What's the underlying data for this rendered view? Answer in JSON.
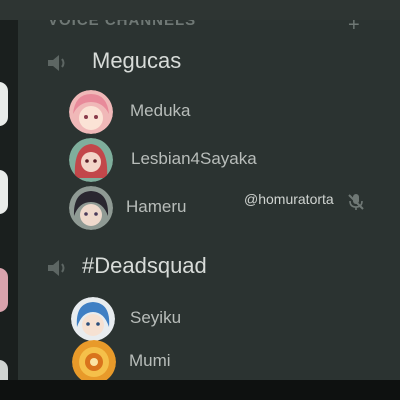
{
  "section_header": {
    "title": "VOICE CHANNELS",
    "add_icon": "plus-icon"
  },
  "channels": [
    {
      "name": "Megucas",
      "icon": "speaker-icon",
      "members": [
        {
          "name": "Meduka",
          "avatar": "pink-haired-anime-avatar"
        },
        {
          "name": "Lesbian4Sayaka",
          "avatar": "red-haired-anime-avatar"
        },
        {
          "name": "Hameru",
          "avatar": "dark-haired-anime-avatar"
        }
      ]
    },
    {
      "name": "#Deadsquad",
      "icon": "speaker-icon",
      "members": [
        {
          "name": "Seyiku",
          "avatar": "blue-haired-anime-avatar"
        },
        {
          "name": "Mumi",
          "avatar": "orange-cartoon-avatar"
        }
      ]
    }
  ],
  "overlay": {
    "streamer_tag": "@homuratorta",
    "mute_icon": "muted-microphone-icon"
  },
  "colors": {
    "panel_bg": "#2b3331",
    "channel_text": "#d8dcd9",
    "member_text": "#b8bdba"
  }
}
